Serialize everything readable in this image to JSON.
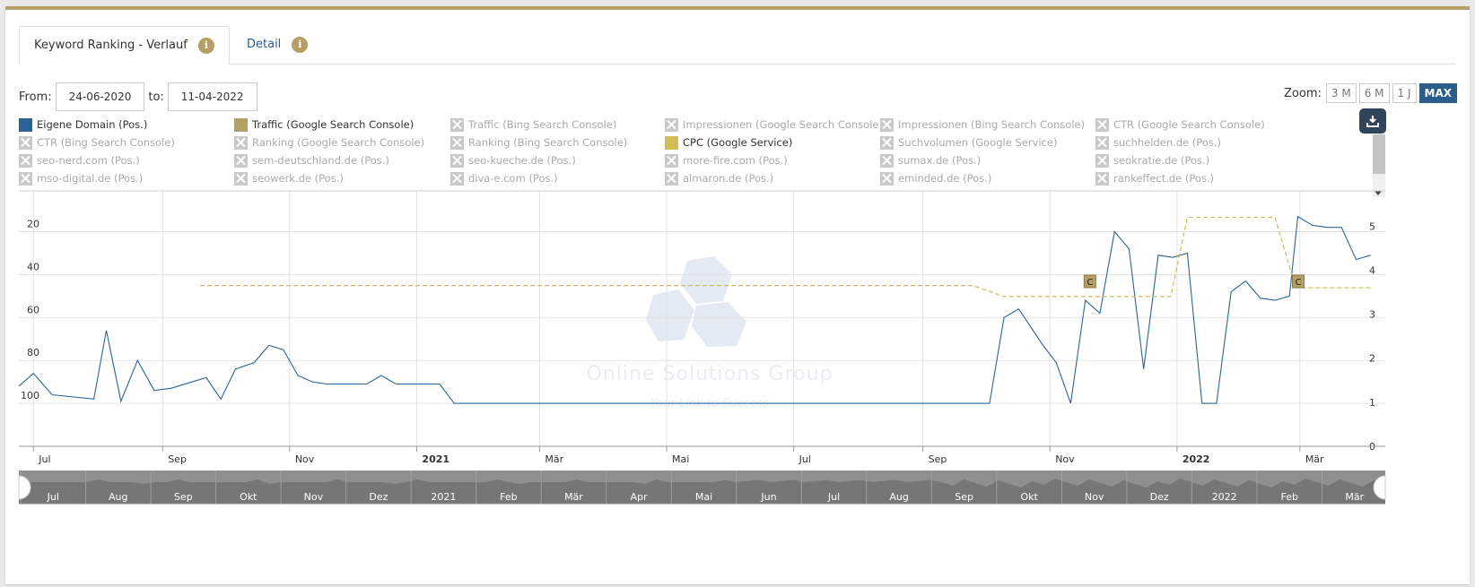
{
  "tabs": [
    {
      "label": "Keyword Ranking - Verlauf",
      "info_icon": "i"
    },
    {
      "label": "Detail",
      "info_icon": "i"
    }
  ],
  "range": {
    "from_label": "From:",
    "from_value": "24-06-2020",
    "to_label": "to:",
    "to_value": "11-04-2022"
  },
  "zoom": {
    "label": "Zoom:",
    "options": [
      "3 M",
      "6 M",
      "1 J",
      "MAX"
    ],
    "selected": "MAX"
  },
  "legend": [
    {
      "label": "Eigene Domain (Pos.)",
      "enabled": true,
      "color": "#2a6496"
    },
    {
      "label": "Traffic (Google Search Console)",
      "enabled": true,
      "color": "#b4a064"
    },
    {
      "label": "Traffic (Bing Search Console)",
      "enabled": false
    },
    {
      "label": "Impressionen (Google Search Console)",
      "enabled": false
    },
    {
      "label": "Impressionen (Bing Search Console)",
      "enabled": false
    },
    {
      "label": "CTR (Google Search Console)",
      "enabled": false
    },
    {
      "label": "CTR (Bing Search Console)",
      "enabled": false
    },
    {
      "label": "Ranking (Google Search Console)",
      "enabled": false
    },
    {
      "label": "Ranking (Bing Search Console)",
      "enabled": false
    },
    {
      "label": "CPC (Google Service)",
      "enabled": true,
      "color": "#d4bc55"
    },
    {
      "label": "Suchvolumen (Google Service)",
      "enabled": false
    },
    {
      "label": "suchhelden.de (Pos.)",
      "enabled": false
    },
    {
      "label": "seo-nerd.com (Pos.)",
      "enabled": false
    },
    {
      "label": "sem-deutschland.de (Pos.)",
      "enabled": false
    },
    {
      "label": "seo-kueche.de (Pos.)",
      "enabled": false
    },
    {
      "label": "more-fire.com (Pos.)",
      "enabled": false
    },
    {
      "label": "sumax.de (Pos.)",
      "enabled": false
    },
    {
      "label": "seokratie.de (Pos.)",
      "enabled": false
    },
    {
      "label": "mso-digital.de (Pos.)",
      "enabled": false
    },
    {
      "label": "seowerk.de (Pos.)",
      "enabled": false
    },
    {
      "label": "diva-e.com (Pos.)",
      "enabled": false
    },
    {
      "label": "almaron.de (Pos.)",
      "enabled": false
    },
    {
      "label": "eminded.de (Pos.)",
      "enabled": false
    },
    {
      "label": "rankeffect.de (Pos.)",
      "enabled": false
    }
  ],
  "watermark": {
    "line1": "Online Solutions Group",
    "line2": "Your Link to Success"
  },
  "chart_data": {
    "type": "line",
    "grid": true,
    "xlim": [
      "2020-06-24",
      "2022-04-11"
    ],
    "y_left": {
      "reversed": true,
      "ticks": [
        20,
        40,
        60,
        80,
        100
      ],
      "ylim": [
        1,
        120
      ]
    },
    "y_right": {
      "ticks": [
        0,
        1,
        2,
        3,
        4,
        5
      ],
      "ylim": [
        0,
        5.8
      ]
    },
    "x_ticks": [
      {
        "label": "Jul",
        "date": "2020-07-01",
        "bold": false
      },
      {
        "label": "Sep",
        "date": "2020-09-01",
        "bold": false
      },
      {
        "label": "Nov",
        "date": "2020-11-01",
        "bold": false
      },
      {
        "label": "2021",
        "date": "2021-01-01",
        "bold": true
      },
      {
        "label": "Mär",
        "date": "2021-03-01",
        "bold": false
      },
      {
        "label": "Mai",
        "date": "2021-05-01",
        "bold": false
      },
      {
        "label": "Jul",
        "date": "2021-07-01",
        "bold": false
      },
      {
        "label": "Sep",
        "date": "2021-09-01",
        "bold": false
      },
      {
        "label": "Nov",
        "date": "2021-11-01",
        "bold": false
      },
      {
        "label": "2022",
        "date": "2022-01-01",
        "bold": true
      },
      {
        "label": "Mär",
        "date": "2022-03-01",
        "bold": false
      }
    ],
    "series": [
      {
        "name": "Eigene Domain (Pos.)",
        "axis": "left",
        "color": "#2a6496",
        "style": "solid",
        "points": [
          [
            "2020-06-24",
            92
          ],
          [
            "2020-07-01",
            86
          ],
          [
            "2020-07-10",
            96
          ],
          [
            "2020-07-30",
            98
          ],
          [
            "2020-08-05",
            66
          ],
          [
            "2020-08-12",
            99
          ],
          [
            "2020-08-20",
            80
          ],
          [
            "2020-08-28",
            94
          ],
          [
            "2020-09-05",
            93
          ],
          [
            "2020-09-15",
            90
          ],
          [
            "2020-09-22",
            88
          ],
          [
            "2020-09-29",
            98
          ],
          [
            "2020-10-06",
            84
          ],
          [
            "2020-10-15",
            81
          ],
          [
            "2020-10-22",
            73
          ],
          [
            "2020-10-29",
            75
          ],
          [
            "2020-11-05",
            87
          ],
          [
            "2020-11-12",
            90
          ],
          [
            "2020-11-19",
            91
          ],
          [
            "2020-12-08",
            91
          ],
          [
            "2020-12-15",
            87
          ],
          [
            "2020-12-22",
            91
          ],
          [
            "2021-01-12",
            91
          ],
          [
            "2021-01-19",
            100
          ],
          [
            "2021-10-03",
            100
          ],
          [
            "2021-10-10",
            60
          ],
          [
            "2021-10-17",
            56
          ],
          [
            "2021-10-28",
            72
          ],
          [
            "2021-11-04",
            81
          ],
          [
            "2021-11-11",
            100
          ],
          [
            "2021-11-18",
            52
          ],
          [
            "2021-11-25",
            58
          ],
          [
            "2021-12-02",
            20
          ],
          [
            "2021-12-09",
            28
          ],
          [
            "2021-12-16",
            84
          ],
          [
            "2021-12-23",
            31
          ],
          [
            "2021-12-30",
            32
          ],
          [
            "2022-01-06",
            30
          ],
          [
            "2022-01-13",
            100
          ],
          [
            "2022-01-20",
            100
          ],
          [
            "2022-01-27",
            48
          ],
          [
            "2022-02-03",
            43
          ],
          [
            "2022-02-10",
            51
          ],
          [
            "2022-02-17",
            52
          ],
          [
            "2022-02-24",
            50
          ],
          [
            "2022-02-28",
            13
          ],
          [
            "2022-03-07",
            17
          ],
          [
            "2022-03-14",
            18
          ],
          [
            "2022-03-21",
            18
          ],
          [
            "2022-03-28",
            33
          ],
          [
            "2022-04-04",
            31
          ]
        ]
      },
      {
        "name": "CPC (Google Service)",
        "axis": "right",
        "color": "#d4bc55",
        "style": "dashed",
        "points": [
          [
            "2020-09-19",
            3.65
          ],
          [
            "2021-09-25",
            3.65
          ],
          [
            "2021-10-10",
            3.4
          ],
          [
            "2021-12-29",
            3.4
          ],
          [
            "2022-01-06",
            5.2
          ],
          [
            "2022-02-17",
            5.2
          ],
          [
            "2022-02-27",
            3.6
          ],
          [
            "2022-04-04",
            3.6
          ]
        ]
      }
    ],
    "flags": [
      {
        "date": "2021-11-20",
        "label": "C"
      },
      {
        "date": "2022-02-28",
        "label": "C"
      }
    ],
    "navigator": {
      "labels": [
        "Jul",
        "Aug",
        "Sep",
        "Okt",
        "Nov",
        "Dez",
        "2021",
        "Feb",
        "Mär",
        "Apr",
        "Mai",
        "Jun",
        "Jul",
        "Aug",
        "Sep",
        "Okt",
        "Nov",
        "Dez",
        "2022",
        "Feb",
        "Mär"
      ]
    }
  }
}
